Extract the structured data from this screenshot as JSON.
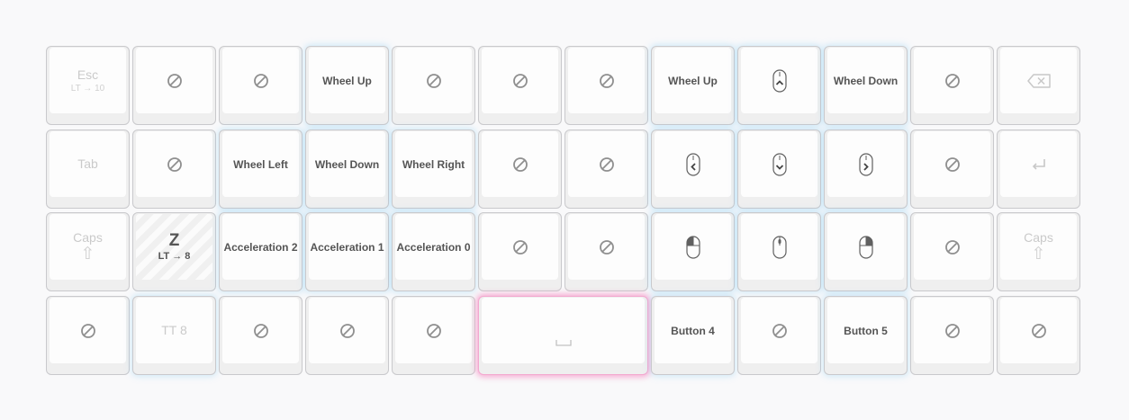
{
  "keys": {
    "r0": {
      "esc": {
        "label": "Esc",
        "sub": "LT → 10"
      },
      "wheel_up_a": "Wheel Up",
      "wheel_up_b": "Wheel Up",
      "wheel_down": "Wheel Down"
    },
    "r1": {
      "tab": "Tab",
      "wheel_left": "Wheel Left",
      "wheel_down": "Wheel Down",
      "wheel_right": "Wheel Right"
    },
    "r2": {
      "caps_left": "Caps",
      "z": {
        "label": "Z",
        "sub": "LT → 8"
      },
      "accel2": "Acceleration 2",
      "accel1": "Acceleration 1",
      "accel0": "Acceleration 0",
      "caps_right": "Caps"
    },
    "r3": {
      "tt8": "TT 8",
      "button4": "Button 4",
      "button5": "Button 5"
    }
  },
  "icons": {
    "none": "no-symbol-icon",
    "backspace": "backspace-icon",
    "enter": "enter-icon",
    "caps": "caps-lock-arrow-icon",
    "space": "space-bar-icon",
    "mouse_up": "mouse-move-up-icon",
    "mouse_left": "mouse-move-left-icon",
    "mouse_down": "mouse-move-down-icon",
    "mouse_right": "mouse-move-right-icon",
    "mouse_btn_left": "mouse-left-click-icon",
    "mouse_btn_middle": "mouse-middle-click-icon",
    "mouse_btn_right": "mouse-right-click-icon"
  },
  "colors": {
    "background": "#f9f9fa",
    "key_border": "#c9c9cc",
    "label": "#555555",
    "faint": "#cacaca",
    "glow_blue": "#78c8f5",
    "glow_pink": "#f48cc3"
  }
}
